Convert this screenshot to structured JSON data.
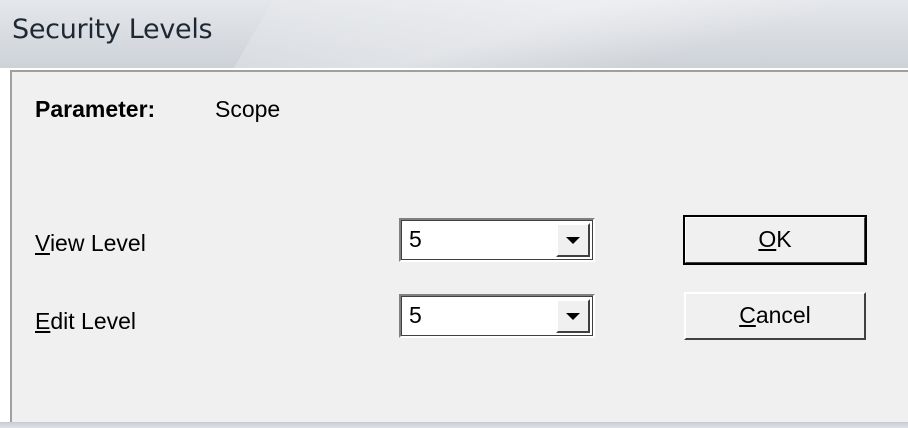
{
  "window": {
    "title": "Security Levels"
  },
  "parameter": {
    "label": "Parameter:",
    "value": "Scope"
  },
  "view_level": {
    "label_mnemonic": "V",
    "label_rest": "iew Level",
    "selected": "5"
  },
  "edit_level": {
    "label_mnemonic": "E",
    "label_rest": "dit Level",
    "selected": "5"
  },
  "buttons": {
    "ok_mnemonic": "O",
    "ok_rest": "K",
    "cancel_mnemonic": "C",
    "cancel_rest": "ancel"
  },
  "icons": {
    "dropdown": "chevron-down-icon"
  }
}
